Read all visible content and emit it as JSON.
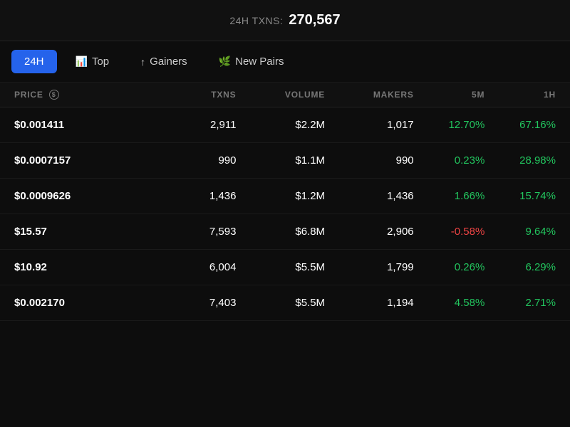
{
  "topbar": {
    "label": "24H TXNS:",
    "value": "270,567"
  },
  "tabs": [
    {
      "id": "24h",
      "label": "24H",
      "icon": "",
      "active": true
    },
    {
      "id": "top",
      "label": "Top",
      "icon": "📊",
      "active": false
    },
    {
      "id": "gainers",
      "label": "Gainers",
      "icon": "↑",
      "active": false
    },
    {
      "id": "new-pairs",
      "label": "New Pairs",
      "icon": "🌿",
      "active": false
    }
  ],
  "columns": [
    {
      "id": "price",
      "label": "PRICE",
      "has_icon": true
    },
    {
      "id": "txns",
      "label": "TXNS"
    },
    {
      "id": "volume",
      "label": "VOLUME"
    },
    {
      "id": "makers",
      "label": "MAKERS"
    },
    {
      "id": "5m",
      "label": "5M"
    },
    {
      "id": "1h",
      "label": "1H"
    }
  ],
  "rows": [
    {
      "price": "$0.001411",
      "txns": "2,911",
      "volume": "$2.2M",
      "makers": "1,017",
      "5m": "12.70%",
      "5m_color": "green",
      "1h": "67.16%",
      "1h_color": "green"
    },
    {
      "price": "$0.0007157",
      "txns": "990",
      "volume": "$1.1M",
      "makers": "990",
      "5m": "0.23%",
      "5m_color": "green",
      "1h": "28.98%",
      "1h_color": "green"
    },
    {
      "price": "$0.0009626",
      "txns": "1,436",
      "volume": "$1.2M",
      "makers": "1,436",
      "5m": "1.66%",
      "5m_color": "green",
      "1h": "15.74%",
      "1h_color": "green"
    },
    {
      "price": "$15.57",
      "txns": "7,593",
      "volume": "$6.8M",
      "makers": "2,906",
      "5m": "-0.58%",
      "5m_color": "red",
      "1h": "9.64%",
      "1h_color": "green"
    },
    {
      "price": "$10.92",
      "txns": "6,004",
      "volume": "$5.5M",
      "makers": "1,799",
      "5m": "0.26%",
      "5m_color": "green",
      "1h": "6.29%",
      "1h_color": "green"
    },
    {
      "price": "$0.002170",
      "txns": "7,403",
      "volume": "$5.5M",
      "makers": "1,194",
      "5m": "4.58%",
      "5m_color": "green",
      "1h": "2.71%",
      "1h_color": "green"
    }
  ]
}
